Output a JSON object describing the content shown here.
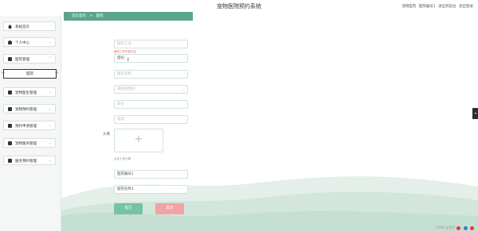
{
  "header": {
    "app_title": "宠物医院预约系统",
    "links": [
      "宠物医院",
      "医院编号1",
      "退出到前台",
      "退出登录"
    ]
  },
  "sidebar": {
    "items": [
      {
        "label": "系统首页",
        "icon": "home-icon"
      },
      {
        "label": "个人中心",
        "icon": "user-icon"
      },
      {
        "label": "医院管理",
        "icon": "grid-icon"
      },
      {
        "label": "宠物医生管理",
        "icon": "grid-icon"
      },
      {
        "label": "宠物预约管理",
        "icon": "monitor-icon"
      },
      {
        "label": "预约申请管理",
        "icon": "grid-icon"
      },
      {
        "label": "宠物服务管理",
        "icon": "bag-icon"
      },
      {
        "label": "服务预约管理",
        "icon": "grid-icon"
      }
    ],
    "sub_item": {
      "label": "医院"
    }
  },
  "breadcrumb": {
    "home": "首页首页",
    "separator": ">",
    "current": "医院"
  },
  "form": {
    "fields": [
      {
        "label": "医院工号",
        "required": true,
        "placeholder": "医院工号",
        "value": ""
      },
      {
        "label": "密码",
        "required": true,
        "placeholder": "",
        "value": "密码"
      },
      {
        "label": "医院名称",
        "required": true,
        "placeholder": "医院名称",
        "value": ""
      },
      {
        "label": "性别",
        "required": false,
        "placeholder": "请选择性别",
        "value": ""
      },
      {
        "label": "职位",
        "required": false,
        "placeholder": "职位",
        "value": ""
      },
      {
        "label": "电话",
        "required": false,
        "placeholder": "电话",
        "value": ""
      },
      {
        "label": "医院编号",
        "required": false,
        "placeholder": "",
        "value": "医院编号1"
      },
      {
        "label": "医院名称",
        "required": false,
        "placeholder": "",
        "value": "医院名称1"
      }
    ],
    "error_message": "医院工号不能为空",
    "photo_label": "头像",
    "upload_hint": "点击上传头像"
  },
  "buttons": {
    "submit": "提交",
    "cancel": "取消"
  },
  "tray": {
    "text": "CSDN @程序"
  },
  "colors": {
    "accent": "#5aa58a",
    "submit": "#76c3a3",
    "cancel": "#f1a3a3",
    "error": "#e85a5a"
  }
}
